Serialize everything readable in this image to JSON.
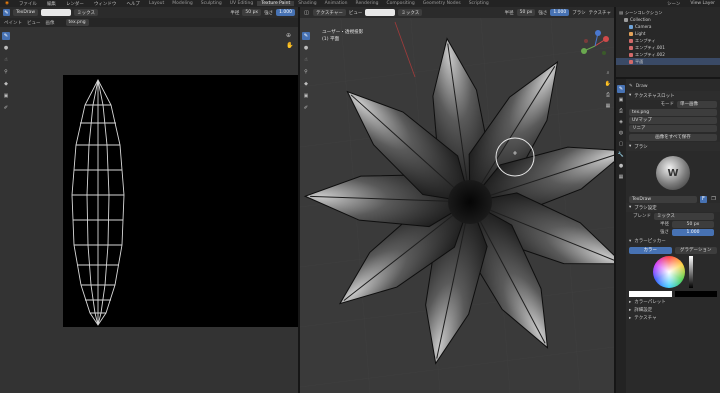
{
  "topbar": {
    "menu": [
      "ファイル",
      "編集",
      "レンダー",
      "ウィンドウ",
      "ヘルプ"
    ],
    "workspaces": [
      "Layout",
      "Modeling",
      "Sculpting",
      "UV Editing",
      "Texture Paint",
      "Shading",
      "Animation",
      "Rendering",
      "Compositing",
      "Geometry Nodes",
      "Scripting"
    ],
    "active_workspace": "Texture Paint",
    "scene": "シーン",
    "view_layer": "View Layer"
  },
  "image_editor": {
    "header": {
      "brush": "TexDraw",
      "blend": "ミックス",
      "radius_label": "半径",
      "radius": "50 px",
      "strength_label": "強さ",
      "strength": "1.000",
      "image_name": "tex.png"
    },
    "header2": [
      "ペイント",
      "ビュー",
      "画像"
    ],
    "tools": [
      "draw-icon",
      "soften-icon",
      "smear-icon",
      "clone-icon",
      "fill-icon",
      "mask-icon",
      "annotate-icon"
    ]
  },
  "viewport": {
    "header": {
      "mode": "テクスチャー",
      "view": "ビュー",
      "blend": "ミックス",
      "radius_label": "半径",
      "radius": "50 px",
      "strength_label": "強さ",
      "strength": "1.000",
      "brush_settings": "ブラシ",
      "texture_settings": "テクスチャ"
    },
    "overlay_title": "ユーザー・透視投影",
    "overlay_subtitle": "(1) 平面",
    "tools": [
      "draw-icon",
      "soften-icon",
      "smear-icon",
      "clone-icon",
      "fill-icon",
      "mask-icon",
      "annotate-icon"
    ]
  },
  "outliner": {
    "title": "シーンコレクション",
    "items": [
      {
        "label": "Collection",
        "color": "#9b9b9b"
      },
      {
        "label": "Camera",
        "color": "#6fa3d8"
      },
      {
        "label": "Light",
        "color": "#e3a35a"
      },
      {
        "label": "エンプティ",
        "color": "#d26a6a"
      },
      {
        "label": "エンプティ.001",
        "color": "#d26a6a"
      },
      {
        "label": "エンプティ.002",
        "color": "#d26a6a"
      },
      {
        "label": "平面",
        "color": "#d26a6a"
      }
    ]
  },
  "properties": {
    "tool_label": "Draw",
    "texture_slots_title": "テクスチャスロット",
    "mode_label": "モード",
    "mode_value": "単一画像",
    "image_name": "tex.png",
    "uv_label": "UVマップ",
    "interp_label": "リニア",
    "save_all": "画像をすべて保存",
    "brushes_title": "ブラシ",
    "brush_name": "TexDraw",
    "brush_settings_title": "ブラシ設定",
    "blend_label": "ブレンド",
    "blend_value": "ミックス",
    "radius_label": "半径",
    "radius_value": "50 px",
    "strength_label": "強さ",
    "strength_value": "1.000",
    "color_picker_title": "カラーピッカー",
    "color_tab": "カラー",
    "gradient_tab": "グラデーション",
    "color_palette": "カラーパレット",
    "advanced": "詳細設定",
    "texture": "テクスチャ",
    "accent": "#4772b3"
  }
}
